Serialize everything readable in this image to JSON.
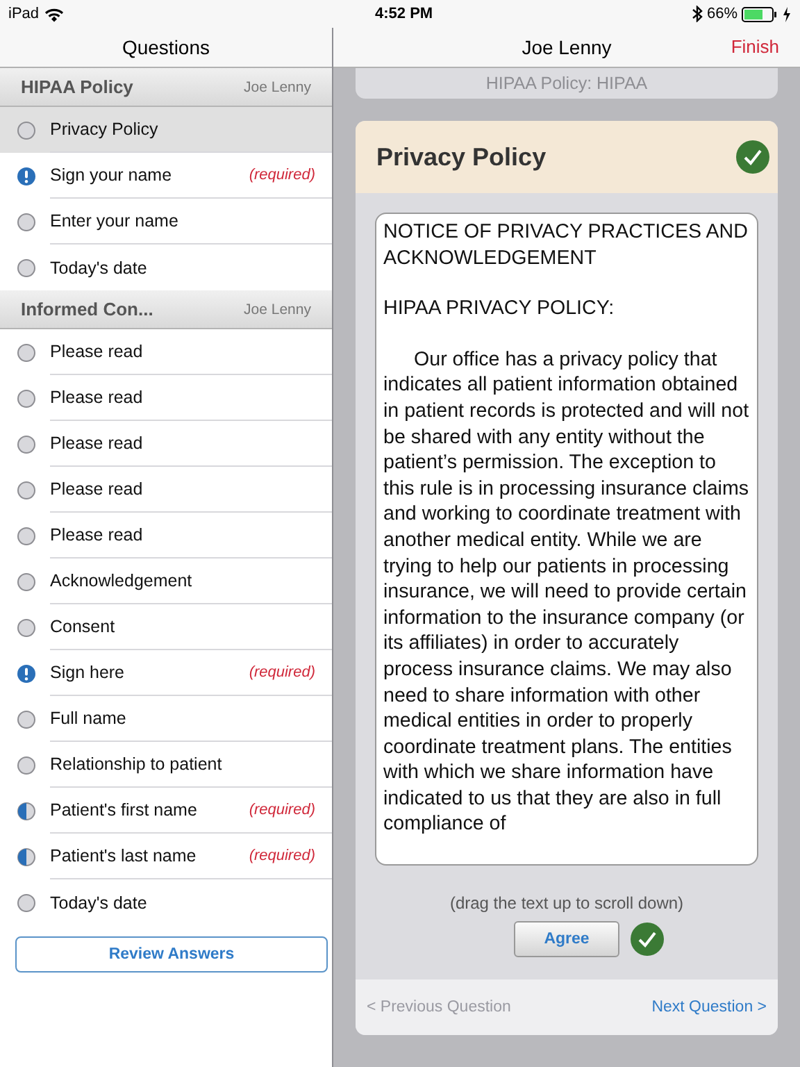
{
  "status_bar": {
    "device": "iPad",
    "time": "4:52 PM",
    "battery": "66%"
  },
  "sidebar": {
    "title": "Questions",
    "sections": [
      {
        "title": "HIPAA Policy",
        "author": "Joe Lenny",
        "items": [
          {
            "label": "Privacy Policy",
            "kind": "empty",
            "selected": true
          },
          {
            "label": "Sign your name",
            "kind": "required",
            "note": "(required)",
            "selected": false
          },
          {
            "label": "Enter your name",
            "kind": "empty",
            "selected": false
          },
          {
            "label": "Today's date",
            "kind": "empty",
            "selected": false
          }
        ]
      },
      {
        "title": "Informed Con...",
        "author": "Joe Lenny",
        "items": [
          {
            "label": "Please read",
            "kind": "empty",
            "selected": false
          },
          {
            "label": "Please read",
            "kind": "empty",
            "selected": false
          },
          {
            "label": "Please read",
            "kind": "empty",
            "selected": false
          },
          {
            "label": "Please read",
            "kind": "empty",
            "selected": false
          },
          {
            "label": "Please read",
            "kind": "empty",
            "selected": false
          },
          {
            "label": "Acknowledgement",
            "kind": "empty",
            "selected": false
          },
          {
            "label": "Consent",
            "kind": "empty",
            "selected": false
          },
          {
            "label": "Sign here",
            "kind": "required",
            "note": "(required)",
            "selected": false
          },
          {
            "label": "Full name",
            "kind": "empty",
            "selected": false
          },
          {
            "label": "Relationship to patient",
            "kind": "empty",
            "selected": false
          },
          {
            "label": "Patient's first name",
            "kind": "partial",
            "note": "(required)",
            "selected": false
          },
          {
            "label": "Patient's last name",
            "kind": "partial",
            "note": "(required)",
            "selected": false
          },
          {
            "label": "Today's date",
            "kind": "empty",
            "selected": false
          }
        ]
      }
    ],
    "review_button": "Review Answers"
  },
  "main": {
    "title": "Joe Lenny",
    "finish": "Finish",
    "form_title": "HIPAA Policy: HIPAA",
    "question": {
      "title": "Privacy Policy",
      "completed": true,
      "text": [
        "NOTICE OF PRIVACY PRACTICES AND ACKNOWLEDGEMENT",
        "HIPAA PRIVACY POLICY:",
        "Our office has a privacy policy that indicates all patient information obtained in patient records is protected and will not be shared with any entity without the patient’s permission. The exception to this rule is in processing insurance claims and working to coordinate treatment with another medical entity. While we are trying to help our patients in processing insurance, we will need to provide certain information to the insurance company (or its affiliates) in order to accurately process insurance claims. We may also need to share information with other medical entities in order to properly coordinate treatment plans. The entities with which we share information have indicated to us that they are also in full compliance of"
      ],
      "hint": "(drag the text up to scroll down)",
      "agree": "Agree",
      "agreed": true
    },
    "previous": {
      "label": "< Previous Question",
      "disabled": true
    },
    "next": {
      "label": "Next Question >",
      "disabled": false
    }
  }
}
